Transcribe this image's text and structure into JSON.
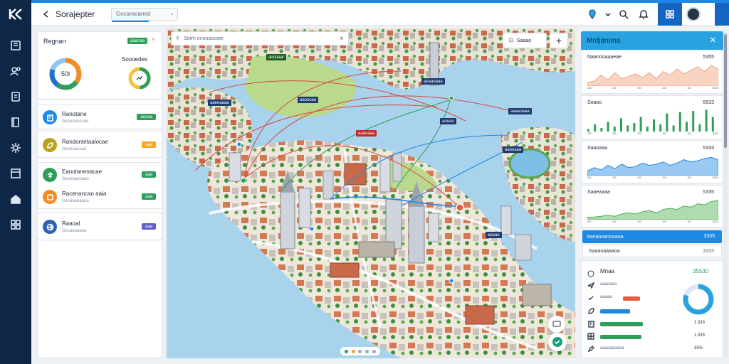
{
  "header": {
    "title": "Sorajepter",
    "breadcrumb": "Gocaraoaned"
  },
  "summary_card": {
    "title": "Regnan",
    "badge": "aaanaa",
    "donut_value": "50l",
    "small_label": "Soooedes",
    "colors": {
      "donut_a": "#f28c28",
      "donut_b": "#2e9e5b",
      "donut_c": "#1e73c8",
      "donut_d": "#8fc7ee"
    }
  },
  "list_a": [
    {
      "title": "Ranotane",
      "sub": "Gecoanocoao",
      "badge": "aooaa",
      "badge_color": "#2e9e5b",
      "icon": "building-icon",
      "icon_color": "#1e88e5"
    },
    {
      "title": "Randontetaalocae",
      "sub": "Gecnaaoaao",
      "badge": "aaa",
      "badge_color": "#f5a623",
      "icon": "leaf-icon",
      "icon_color": "#b7a21a"
    }
  ],
  "list_b": [
    {
      "title": "Eanotanenacae",
      "sub": "Gecnaaooaao",
      "badge": "aaa",
      "badge_color": "#2e9e5b",
      "icon": "tree-icon",
      "icon_color": "#2e9e5b"
    },
    {
      "title": "Racenancao aaia",
      "sub": "Gecaaoeaaoa",
      "badge": "aaa",
      "badge_color": "#2e9e5b",
      "icon": "tag-icon",
      "icon_color": "#f28c28"
    }
  ],
  "list_c": [
    {
      "title": "Raaoal",
      "sub": "Gecaaoaaea",
      "badge": "aaa",
      "badge_color": "#5b5fc7",
      "icon": "globe-icon",
      "icon_color": "#2f62b5"
    }
  ],
  "map": {
    "search_placeholder": "Sotrh enooaooote",
    "layers_label": "Saaao",
    "zoom_in": "+",
    "labels": [
      {
        "text": "aooaaar",
        "color": "#1b5e20"
      },
      {
        "text": "aaeeaaaa",
        "color": "#1e3a6e"
      },
      {
        "text": "aaoooao",
        "color": "#1e3a6e"
      },
      {
        "text": "aoaaoaaa",
        "color": "#1e3a6e"
      },
      {
        "text": "aooao",
        "color": "#1e3a6e"
      },
      {
        "text": "aaaeoaaa",
        "color": "#1e3a6e"
      },
      {
        "text": "aaaoaaa",
        "color": "#c62828"
      },
      {
        "text": "aaooaaa",
        "color": "#1e3a6e"
      },
      {
        "text": "aoaao",
        "color": "#1e3a6e"
      },
      {
        "text": "aaooaaaa",
        "color": "#1e3a6e"
      },
      {
        "text": "aaaaaaaa",
        "color": "#1e3a6e"
      }
    ]
  },
  "right_panel": {
    "title": "Mrdjanona",
    "charts": [
      {
        "label": "Naanooaaaeae",
        "value": "5355",
        "color": "#f2a07b",
        "axis": [
          "aa",
          "aa",
          "aa",
          "aa",
          "aa",
          "aaa"
        ]
      },
      {
        "label": "Soaoo",
        "value": "5533",
        "color": "#2e9e5b",
        "axis": [
          "aa",
          "aa",
          "aa",
          "aa",
          "aa",
          "aaa"
        ]
      },
      {
        "label": "Saaoaaa",
        "value": "5333",
        "color": "#1e88e5",
        "axis": [
          "aa",
          "aa",
          "aa",
          "aa",
          "aa",
          "aaa"
        ]
      },
      {
        "label": "Saaeaaaa",
        "value": "5335",
        "color": "#4caf50",
        "axis": [
          "aa",
          "aa",
          "aa",
          "aa",
          "aa",
          "aaa"
        ]
      }
    ],
    "highlight_row": {
      "label": "Soeaooanooaoa",
      "value": "3355"
    },
    "second_row": {
      "label": "Saaanaaaaoa",
      "value": "3333"
    },
    "stats": {
      "title": "Mnaa",
      "total": "35530",
      "rows": [
        {
          "label": "aaaeaao",
          "value": "",
          "icon": "plane-icon"
        },
        {
          "label": "aaaaa",
          "value": "",
          "icon": "check-icon",
          "bar_color": "#e85d3f",
          "bar_pct": 0.2
        },
        {
          "label": "",
          "value": "",
          "icon": "leaf-icon",
          "bar_color": "#1e88e5",
          "bar_pct": 0.35
        },
        {
          "label": "",
          "value": "1.333",
          "icon": "building-icon",
          "bar_color": "#2e9e5b",
          "bar_pct": 0.5
        },
        {
          "label": "",
          "value": "1.333",
          "icon": "grid-icon",
          "bar_color": "#2e9e5b",
          "bar_pct": 0.48
        },
        {
          "label": "aaaaaaaaoa",
          "value": "35%",
          "icon": "pencil-icon"
        }
      ],
      "ring_pct": 0.8
    }
  }
}
